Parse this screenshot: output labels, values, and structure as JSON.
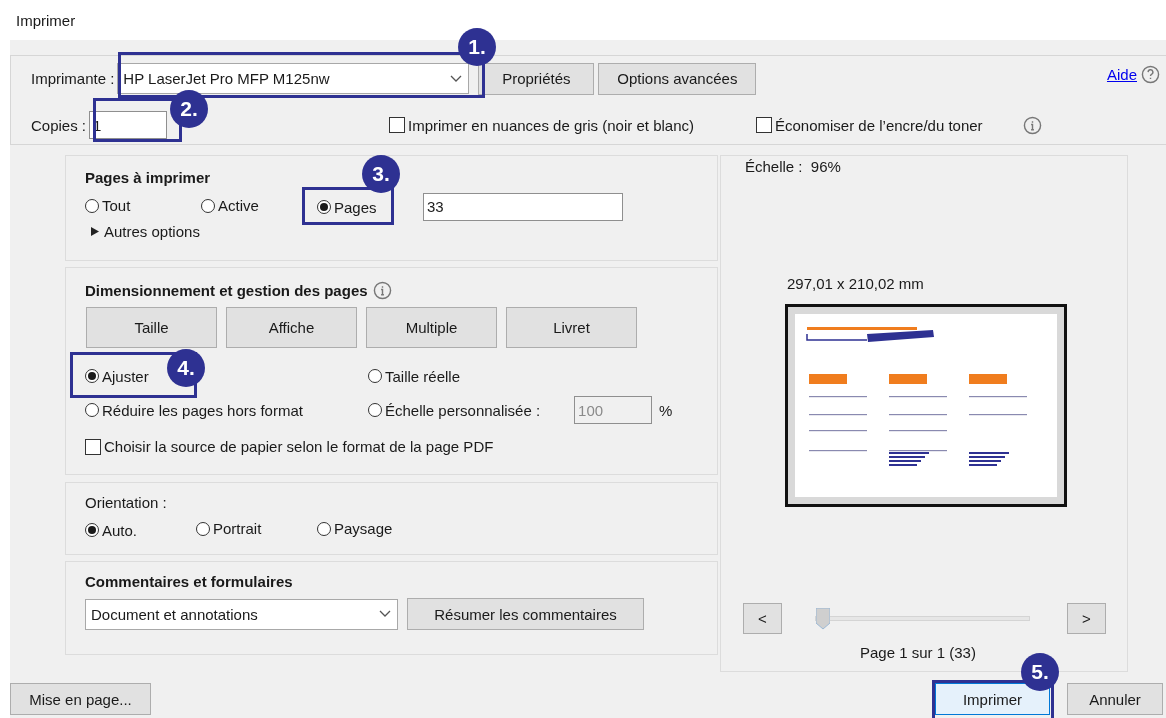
{
  "window": {
    "title": "Imprimer"
  },
  "printer": {
    "label": "Imprimante :",
    "value": "HP LaserJet Pro MFP M125nw"
  },
  "top_buttons": [
    "Propriétés",
    "Options avancées"
  ],
  "help": {
    "label": "Aide"
  },
  "copies": {
    "label": "Copies :",
    "value": "1"
  },
  "top_options": [
    {
      "label": "Imprimer en nuances de gris (noir et blanc)",
      "checked": false
    },
    {
      "label": "Économiser de l’encre/du toner",
      "checked": false
    }
  ],
  "pages_section": {
    "title": "Pages à imprimer",
    "options": [
      {
        "label": "Tout",
        "selected": false
      },
      {
        "label": "Active",
        "selected": false
      },
      {
        "label": "Pages",
        "selected": true
      }
    ],
    "range": "33",
    "more": {
      "label": "Autres options",
      "expanded": false
    }
  },
  "sizing": {
    "title": "Dimensionnement et gestion des pages",
    "tabs": [
      "Taille",
      "Affiche",
      "Multiple",
      "Livret"
    ],
    "options": [
      {
        "label": "Ajuster",
        "selected": true
      },
      {
        "label": "Taille réelle",
        "selected": false
      },
      {
        "label": "Réduire les pages hors format",
        "selected": false
      },
      {
        "label": "Échelle personnalisée :",
        "selected": false
      }
    ],
    "scale": {
      "value": "100",
      "unit": "%",
      "disabled": true
    },
    "paper_source": {
      "label": "Choisir la source de papier selon le format de la page PDF",
      "checked": false
    }
  },
  "orientation": {
    "title": "Orientation :",
    "options": [
      {
        "label": "Auto.",
        "selected": true
      },
      {
        "label": "Portrait",
        "selected": false
      },
      {
        "label": "Paysage",
        "selected": false
      }
    ]
  },
  "comments": {
    "title": "Commentaires et formulaires",
    "value": "Document et annotations",
    "button": "Résumer les commentaires"
  },
  "preview": {
    "scale": "Échelle :  96%",
    "size": "297,01 x 210,02 mm",
    "prev": "<",
    "next": ">",
    "slider": {
      "level": 0
    },
    "page": "Page 1 sur 1 (33)"
  },
  "footer": {
    "setup": "Mise en page...",
    "print": "Imprimer",
    "cancel": "Annuler"
  },
  "callouts": [
    {
      "label": "1."
    },
    {
      "label": "2."
    },
    {
      "label": "3."
    },
    {
      "label": "4."
    },
    {
      "label": "5."
    }
  ]
}
